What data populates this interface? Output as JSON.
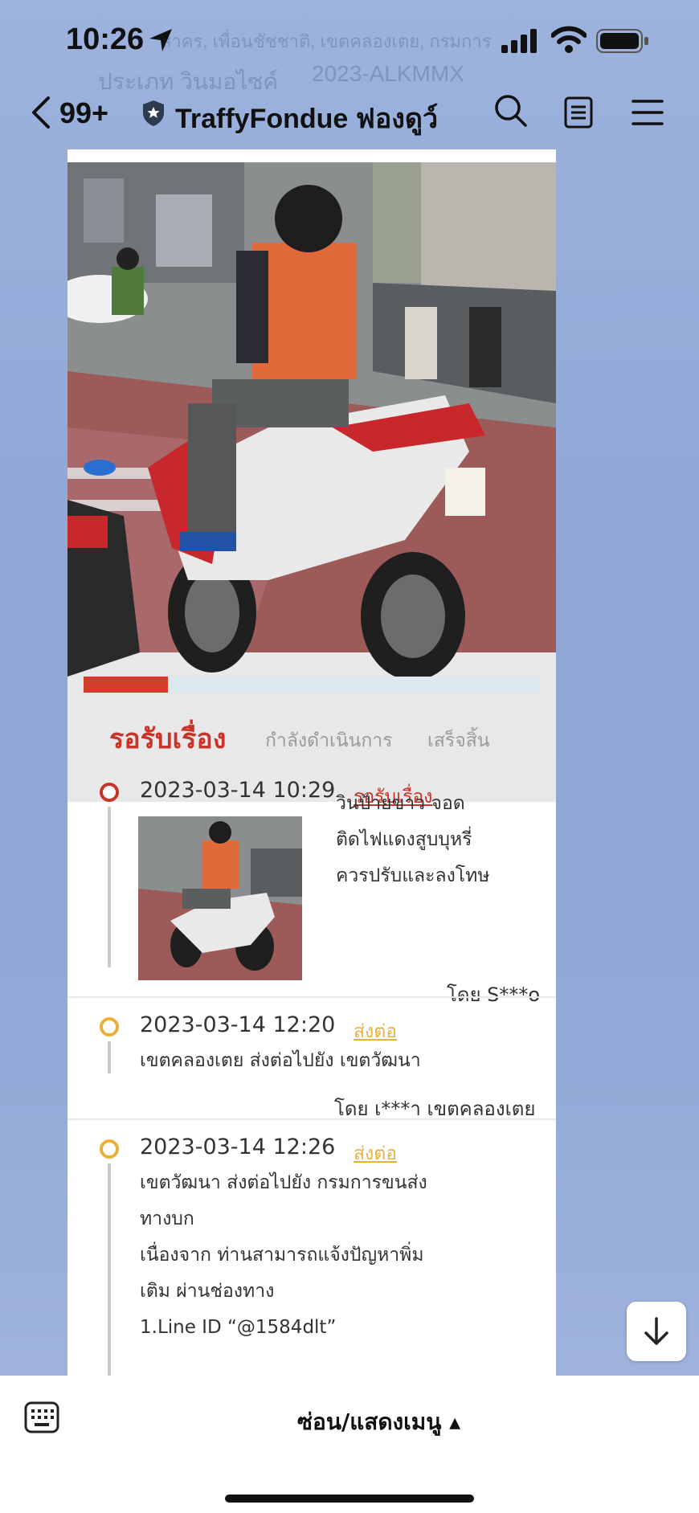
{
  "status_bar": {
    "time": "10:26"
  },
  "ghost_text": {
    "line1": "สาคร, เพื่อนชัชชาติ, เขตคลองเตย, กรมการ",
    "line2": "ประเภท วินมอไซค์",
    "line3": "2023-ALKMMX"
  },
  "nav": {
    "back_count": "99+",
    "title": "TraffyFondue ฟองดูว์"
  },
  "report": {
    "progress_fraction": 0.185,
    "tabs": [
      "รอรับเรื่อง",
      "กำลังดำเนินการ",
      "เสร็จสิ้น"
    ],
    "timeline": [
      {
        "date": "2023-03-14 10:29",
        "status": "รอรับเรื่อง",
        "status_color": "#c9342a",
        "lines": [
          "วินป้ายขาว จอด",
          "ติดไฟแดงสูบบุหรี่",
          "ควรปรับและลงโทษ"
        ],
        "by": "โดย S***o"
      },
      {
        "date": "2023-03-14 12:20",
        "status": "ส่งต่อ",
        "status_color": "#e8b23a",
        "lines": [
          "เขตคลองเตย ส่งต่อไปยัง เขตวัฒนา"
        ],
        "by": "โดย เ***า เขตคลองเตย"
      },
      {
        "date": "2023-03-14 12:26",
        "status": "ส่งต่อ",
        "status_color": "#e8b23a",
        "lines": [
          "เขตวัฒนา ส่งต่อไปยัง กรมการขนส่ง",
          "ทางบก",
          "เนื่องจาก ท่านสามารถแจ้งปัญหาพิ่ม",
          "เติม ผ่านช่องทาง",
          "1.Line ID “@1584dlt”"
        ]
      }
    ]
  },
  "bottom": {
    "menu_toggle": "ซ่อน/แสดงเมนู ▴"
  },
  "icons": {
    "back": "chevron-left-icon",
    "shield": "shield-star-icon",
    "search": "search-icon",
    "note": "note-icon",
    "menu": "hamburger-menu-icon",
    "scroll": "arrow-down-icon",
    "keyboard": "keyboard-icon"
  }
}
